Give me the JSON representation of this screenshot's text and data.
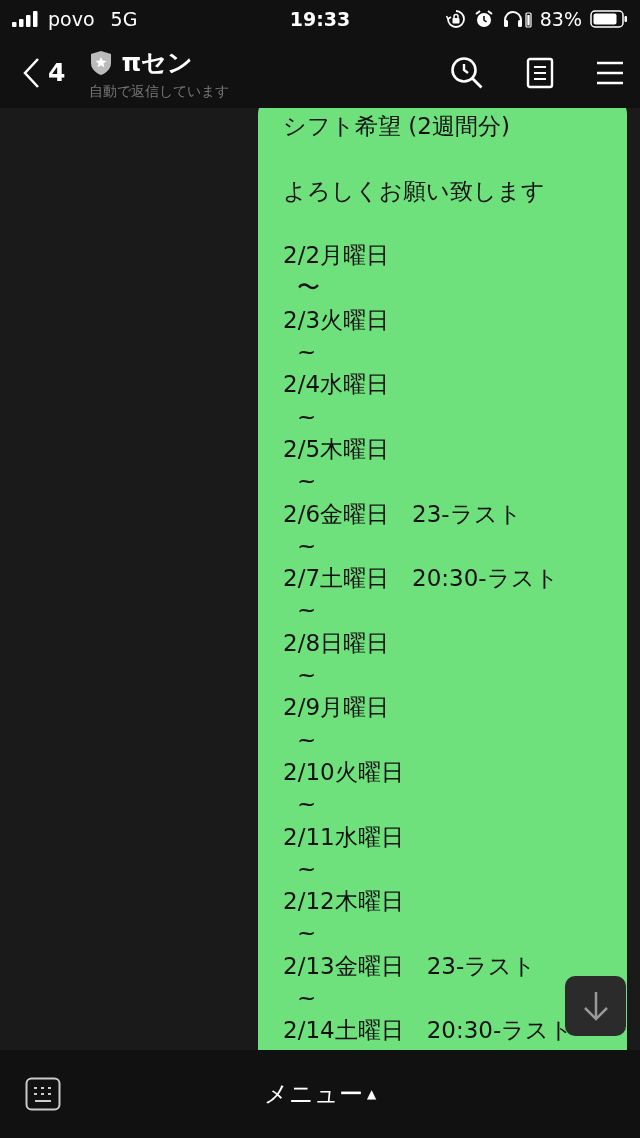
{
  "status_bar": {
    "carrier": "povo",
    "network": "5G",
    "time": "19:33",
    "battery": "83%"
  },
  "header": {
    "back_count": "4",
    "title": "πセン",
    "subtitle": "自動で返信しています"
  },
  "message": {
    "blocks": [
      [
        {
          "kind": "text",
          "text": "シフト希望 (2週間分)"
        }
      ],
      [
        {
          "kind": "text",
          "text": "よろしくお願い致します"
        }
      ],
      [
        {
          "kind": "text",
          "text": "2/2月曜日"
        },
        {
          "kind": "sep",
          "text": "〜"
        },
        {
          "kind": "text",
          "text": "2/3火曜日"
        },
        {
          "kind": "sep",
          "text": "~"
        },
        {
          "kind": "text",
          "text": "2/4水曜日"
        },
        {
          "kind": "sep",
          "text": "~"
        },
        {
          "kind": "text",
          "text": "2/5木曜日"
        },
        {
          "kind": "sep",
          "text": "~"
        },
        {
          "kind": "text",
          "text": "2/6金曜日　23-ラスト"
        },
        {
          "kind": "sep",
          "text": "~"
        },
        {
          "kind": "text",
          "text": "2/7土曜日　20:30-ラスト"
        },
        {
          "kind": "sep",
          "text": "~"
        },
        {
          "kind": "text",
          "text": "2/8日曜日"
        },
        {
          "kind": "sep",
          "text": "~"
        },
        {
          "kind": "text",
          "text": "2/9月曜日"
        },
        {
          "kind": "sep",
          "text": "~"
        },
        {
          "kind": "text",
          "text": "2/10火曜日"
        },
        {
          "kind": "sep",
          "text": "~"
        },
        {
          "kind": "text",
          "text": "2/11水曜日"
        },
        {
          "kind": "sep",
          "text": "~"
        },
        {
          "kind": "text",
          "text": "2/12木曜日"
        },
        {
          "kind": "sep",
          "text": "~"
        },
        {
          "kind": "text",
          "text": "2/13金曜日　23-ラスト"
        },
        {
          "kind": "sep",
          "text": "~"
        },
        {
          "kind": "text",
          "text": "2/14土曜日　20:30-ラスト"
        }
      ]
    ]
  },
  "bottom_bar": {
    "menu_label": "メニュー",
    "menu_arrow": "▲"
  }
}
